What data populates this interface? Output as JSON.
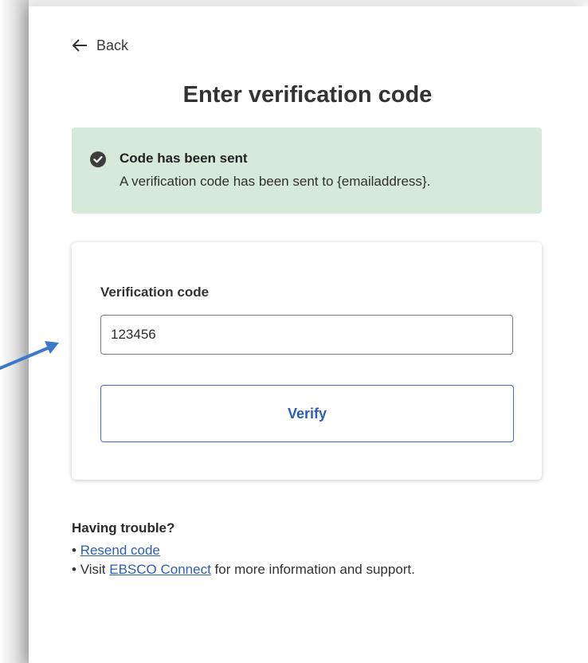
{
  "back": {
    "label": "Back"
  },
  "title": "Enter verification code",
  "alert": {
    "title": "Code has been sent",
    "message": "A verification code has been sent to {emailaddress}.",
    "icon": "check-circle-icon",
    "background": "#d6eadb"
  },
  "form": {
    "label": "Verification code",
    "value": "123456",
    "verify_label": "Verify"
  },
  "help": {
    "title": "Having trouble?",
    "bullet": "•",
    "resend_label": "Resend code",
    "visit_prefix": "Visit",
    "connect_label": "EBSCO Connect",
    "visit_suffix": "for more information and support."
  },
  "colors": {
    "link": "#2c5fb4",
    "annotation_arrow": "#3b78c8"
  }
}
